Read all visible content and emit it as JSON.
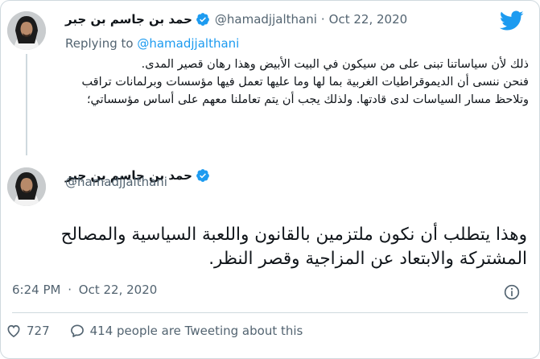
{
  "tweet_parent": {
    "display_name": "حمد بن جاسم بن جبر",
    "handle": "@hamadjjalthani",
    "separator": "·",
    "date": "Oct 22, 2020",
    "replying_to_prefix": "Replying to",
    "replying_to_handle": "@hamadjjalthani",
    "text_lines": [
      "ذلك لأن سياساتنا تبنى على من سيكون في البيت الأبيض وهذا رهان قصير المدى.",
      "فنحن ننسى أن الديموقراطيات الغربية بما لها وما عليها تعمل فيها مؤسسات وبرلمانات تراقب وتلاحظ مسار السياسات لدى قادتها. ولذلك يجب أن يتم تعاملنا معهم على أساس مؤسساتي؛"
    ]
  },
  "tweet_main": {
    "display_name": "حمد بن جاسم بن جبر",
    "handle": "@hamadjjalthani",
    "text": "وهذا يتطلب أن نكون ملتزمين بالقانون واللعبة السياسية والمصالح المشتركة والابتعاد عن المزاجية وقصر النظر.",
    "time": "6:24 PM",
    "separator": "·",
    "date": "Oct 22, 2020"
  },
  "actions": {
    "like_count": "727",
    "tweeting_text": "414 people are Tweeting about this"
  },
  "colors": {
    "twitter_blue": "#1d9bf0",
    "text_secondary": "#536471",
    "border": "#cfd9de"
  },
  "icons": {
    "logo": "twitter-bird-icon",
    "verified": "verified-badge-icon",
    "info": "info-icon",
    "like": "heart-icon",
    "reply": "speech-bubble-icon"
  }
}
